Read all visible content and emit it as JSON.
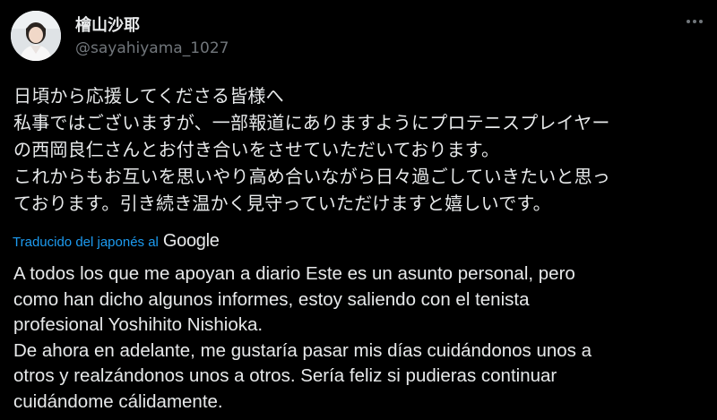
{
  "author": {
    "display_name": "檜山沙耶",
    "handle": "@sayahiyama_1027",
    "avatar_icon": "profile-photo"
  },
  "menu": {
    "more_icon": "more-horizontal-icon"
  },
  "post": {
    "original_lines": [
      "日頃から応援してくださる皆様へ",
      "私事ではございますが、一部報道にありますようにプロテニスプレイヤー",
      "の西岡良仁さんとお付き合いをさせていただいております。",
      "これからもお互いを思いやり高め合いながら日々過ごしていきたいと思っ",
      "ております。引き続き温かく見守っていただけますと嬉しいです。"
    ],
    "translated_label": "Traducido del japonés al",
    "translator_brand": "Google",
    "translation_lines": [
      "A todos los que me apoyan a diario Este es un asunto personal, pero",
      "como han dicho algunos informes, estoy saliendo con el tenista",
      "profesional Yoshihito Nishioka.",
      "De ahora en adelante, me gustaría pasar mis días cuidándonos unos a",
      "otros y realzándonos unos a otros. Sería feliz si pudieras continuar",
      "cuidándome cálidamente."
    ]
  },
  "colors": {
    "background": "#000000",
    "text": "#e7e9ea",
    "secondary_text": "#71767b",
    "link": "#1d9bf0"
  }
}
